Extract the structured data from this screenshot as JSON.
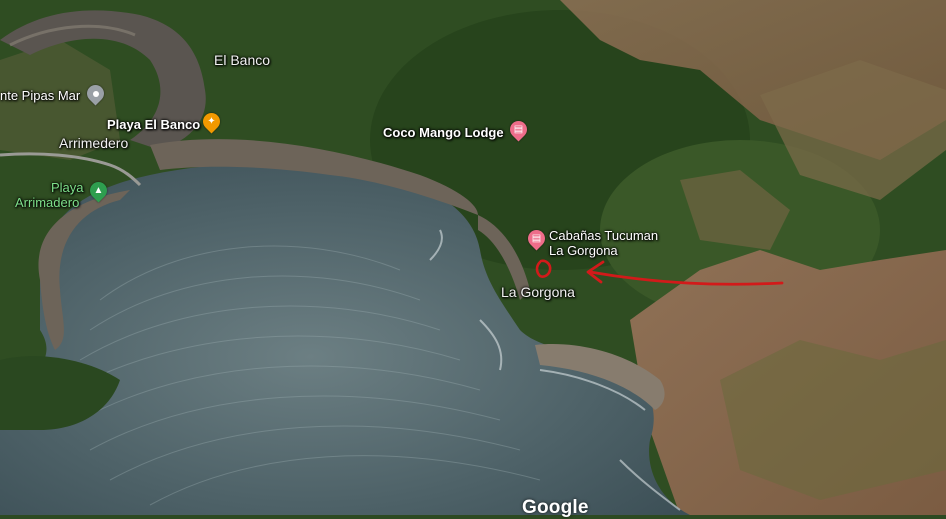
{
  "colors": {
    "ocean": "#4e6268",
    "forest": "#2f4d22",
    "dry_land": "#8b6a4e",
    "sand": "#6d6459",
    "annotation": "#d21a1a",
    "label_text": "#ffffff",
    "park_text": "#7ee08a"
  },
  "places": {
    "el_banco": "El Banco",
    "pipas_mar": "nte Pipas Mar",
    "playa_el_banco": "Playa El Banco",
    "coco_mango": "Coco Mango Lodge",
    "arrimedero": "Arrimedero",
    "playa_arrimadero_1": "Playa",
    "playa_arrimadero_2": "Arrimadero",
    "cabanas_1": "Cabañas Tucuman",
    "cabanas_2": "La Gorgona",
    "la_gorgona": "La Gorgona"
  },
  "icons": {
    "pipas_mar": "location-icon",
    "playa_el_banco": "restaurant-icon",
    "coco_mango": "hotel-icon",
    "playa_arrimadero": "park-icon",
    "cabanas": "hotel-icon"
  },
  "branding": {
    "logo": "Google"
  }
}
